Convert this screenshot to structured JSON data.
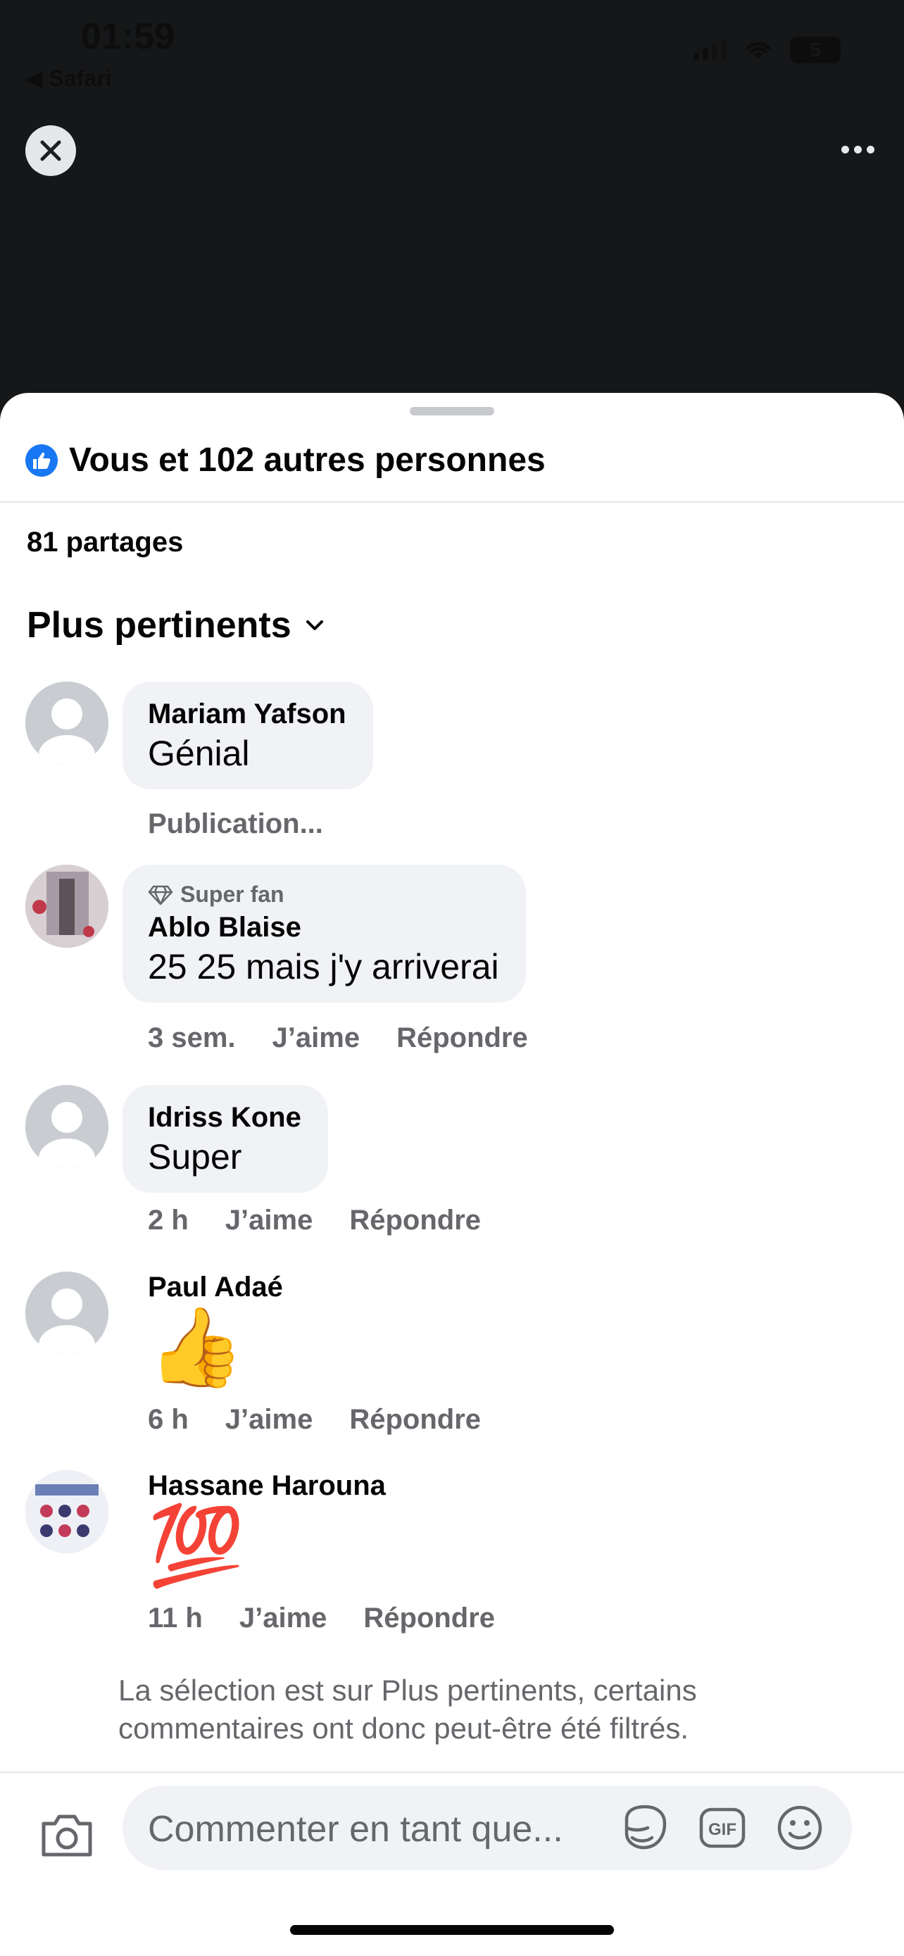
{
  "status_bar": {
    "time": "01:59",
    "back_app": "◀ Safari",
    "battery": "5"
  },
  "sheet": {
    "reactions_text": "Vous et 102 autres personnes",
    "shares_text": "81 partages",
    "sort_label": "Plus pertinents"
  },
  "comments": [
    {
      "name": "Mariam Yafson",
      "text": "Génial",
      "meta_status": "Publication..."
    },
    {
      "badge": "Super fan",
      "name": "Ablo Blaise",
      "text": "25 25 mais j'y arriverai",
      "time": "3 sem.",
      "like": "J’aime",
      "reply": "Répondre"
    },
    {
      "name": "Idriss Kone",
      "text": "Super",
      "time": "2 h",
      "like": "J’aime",
      "reply": "Répondre"
    },
    {
      "name": "Paul Adaé",
      "emoji": "👍",
      "time": "6 h",
      "like": "J’aime",
      "reply": "Répondre"
    },
    {
      "name": "Hassane Harouna",
      "emoji": "💯",
      "time": "11 h",
      "like": "J’aime",
      "reply": "Répondre"
    }
  ],
  "filter_note": "La sélection est sur Plus pertinents, certains commentaires ont donc peut-être été filtrés.",
  "composer": {
    "placeholder": "Commenter en tant que..."
  },
  "colors": {
    "accent": "#1877f2",
    "bubble": "#f0f2f5",
    "secondary_text": "#65676b"
  }
}
